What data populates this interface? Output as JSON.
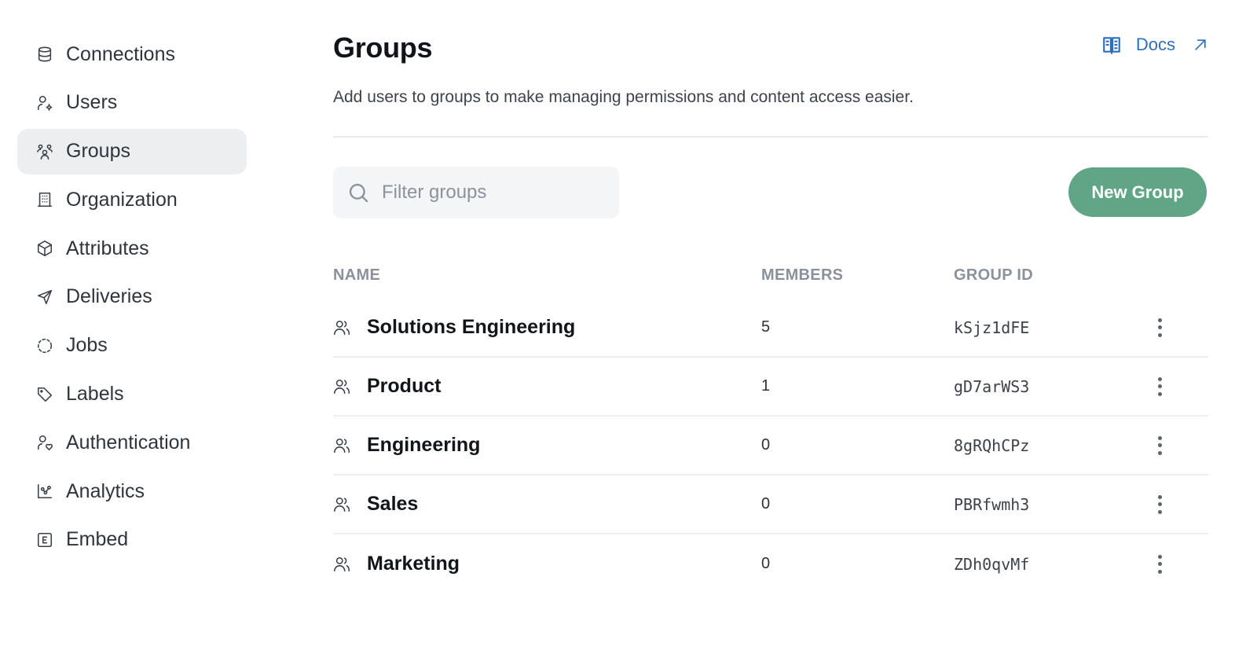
{
  "sidebar": {
    "items": [
      {
        "label": "Connections",
        "icon": "database-icon",
        "active": false
      },
      {
        "label": "Users",
        "icon": "user-gear-icon",
        "active": false
      },
      {
        "label": "Groups",
        "icon": "users-group-icon",
        "active": true
      },
      {
        "label": "Organization",
        "icon": "building-icon",
        "active": false
      },
      {
        "label": "Attributes",
        "icon": "cube-icon",
        "active": false
      },
      {
        "label": "Deliveries",
        "icon": "send-icon",
        "active": false
      },
      {
        "label": "Jobs",
        "icon": "dashed-circle-icon",
        "active": false
      },
      {
        "label": "Labels",
        "icon": "tag-icon",
        "active": false
      },
      {
        "label": "Authentication",
        "icon": "user-shield-icon",
        "active": false
      },
      {
        "label": "Analytics",
        "icon": "chart-icon",
        "active": false
      },
      {
        "label": "Embed",
        "icon": "embed-icon",
        "active": false
      }
    ]
  },
  "header": {
    "title": "Groups",
    "subtitle": "Add users to groups to make managing permissions and content access easier.",
    "docs_label": "Docs"
  },
  "toolbar": {
    "search_placeholder": "Filter groups",
    "search_value": "",
    "new_group_label": "New Group"
  },
  "table": {
    "columns": [
      "NAME",
      "MEMBERS",
      "GROUP ID"
    ],
    "rows": [
      {
        "name": "Solutions Engineering",
        "members": "5",
        "group_id": "kSjz1dFE"
      },
      {
        "name": "Product",
        "members": "1",
        "group_id": "gD7arWS3"
      },
      {
        "name": "Engineering",
        "members": "0",
        "group_id": "8gRQhCPz"
      },
      {
        "name": "Sales",
        "members": "0",
        "group_id": "PBRfwmh3"
      },
      {
        "name": "Marketing",
        "members": "0",
        "group_id": "ZDh0qvMf"
      }
    ]
  },
  "colors": {
    "accent_green": "#5fa586",
    "link_blue": "#2e6fbd",
    "active_nav_bg": "#eceef0"
  }
}
